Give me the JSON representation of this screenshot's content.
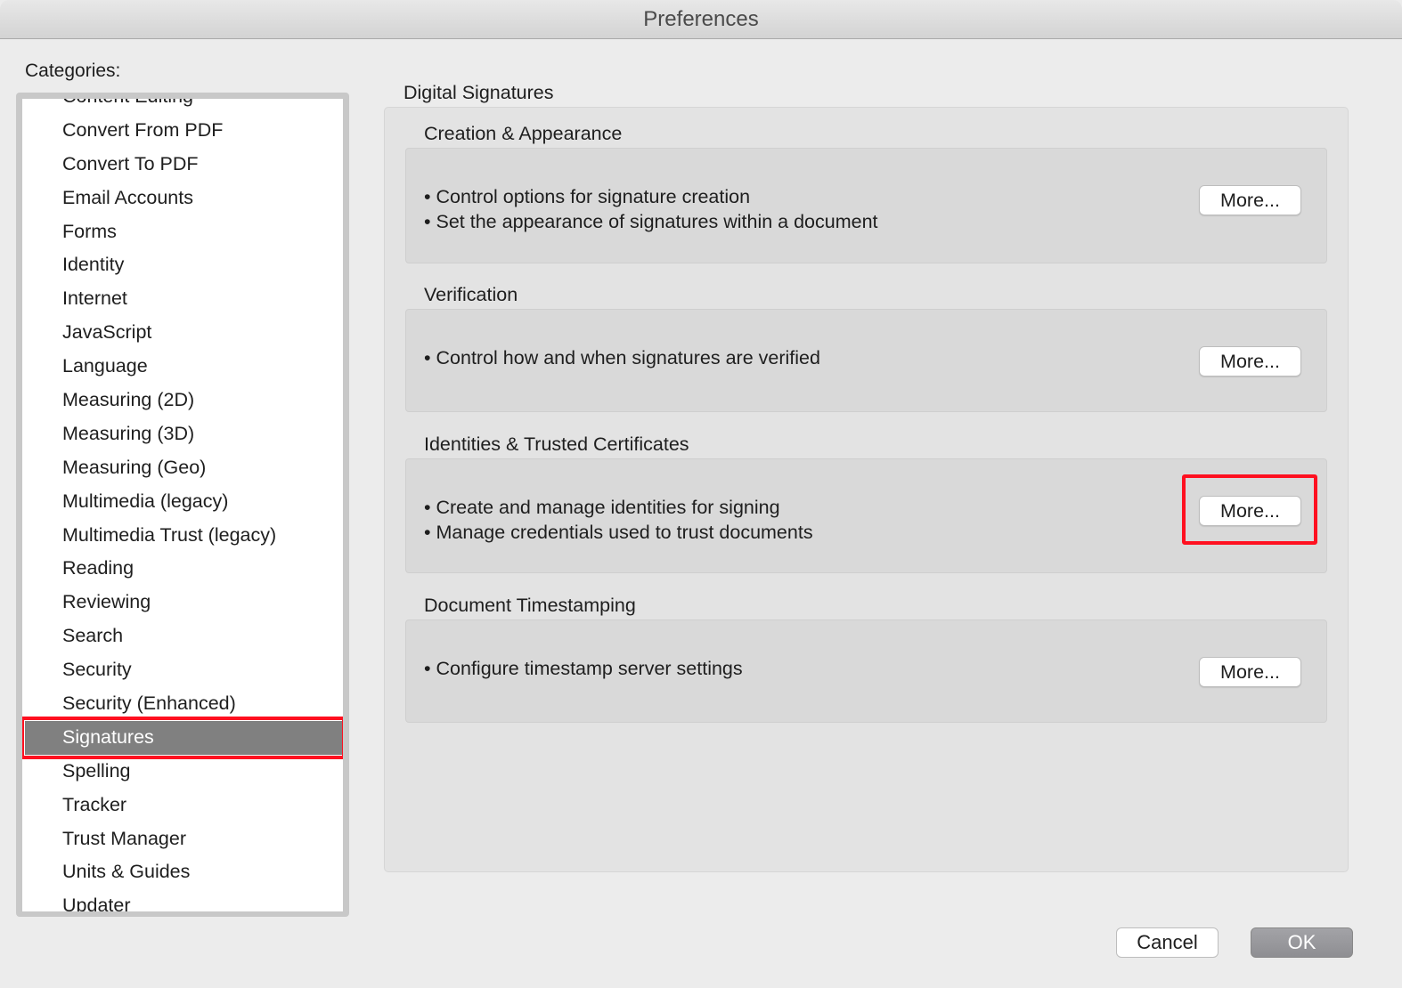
{
  "window": {
    "title": "Preferences"
  },
  "categories": {
    "label": "Categories:",
    "items": [
      "Content Editing",
      "Convert From PDF",
      "Convert To PDF",
      "Email Accounts",
      "Forms",
      "Identity",
      "Internet",
      "JavaScript",
      "Language",
      "Measuring (2D)",
      "Measuring (3D)",
      "Measuring (Geo)",
      "Multimedia (legacy)",
      "Multimedia Trust (legacy)",
      "Reading",
      "Reviewing",
      "Search",
      "Security",
      "Security (Enhanced)",
      "Signatures",
      "Spelling",
      "Tracker",
      "Trust Manager",
      "Units & Guides",
      "Updater"
    ],
    "selected": "Signatures"
  },
  "main": {
    "title": "Digital Signatures",
    "sections": [
      {
        "title": "Creation & Appearance",
        "bullets": [
          "• Control options for signature creation",
          "• Set the appearance of signatures within a document"
        ],
        "button": "More..."
      },
      {
        "title": "Verification",
        "bullets": [
          "• Control how and when signatures are verified"
        ],
        "button": "More..."
      },
      {
        "title": "Identities & Trusted Certificates",
        "bullets": [
          "• Create and manage identities for signing",
          "• Manage credentials used to trust documents"
        ],
        "button": "More..."
      },
      {
        "title": "Document Timestamping",
        "bullets": [
          "• Configure timestamp server settings"
        ],
        "button": "More..."
      }
    ]
  },
  "footer": {
    "cancel": "Cancel",
    "ok": "OK"
  },
  "colors": {
    "highlight": "#ff1020",
    "selection": "#808080"
  }
}
